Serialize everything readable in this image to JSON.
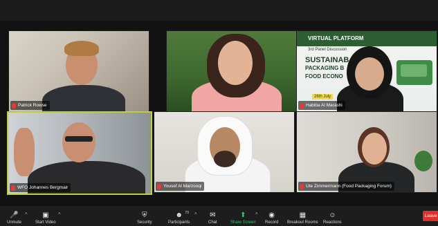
{
  "participants": [
    {
      "name": "Patrick Rowse",
      "muted": true
    },
    {
      "name": "",
      "muted": false
    },
    {
      "name": "Habiba Al Marashi",
      "muted": true
    },
    {
      "name": "WFO Johannes Bergmair",
      "muted": true
    },
    {
      "name": "Yousef Al Marzooqi",
      "muted": true
    },
    {
      "name": "Ute Zimmermann (Food Packaging Forum)",
      "muted": true
    }
  ],
  "slide": {
    "line1": "VIRTUAL PLATFORM",
    "line2": "3rd Panel Discussion",
    "heading_a": "SUSTAINAB",
    "heading_b": "PACKAGING B",
    "heading_c": "FOOD ECONO",
    "date": "26th July"
  },
  "toolbar": {
    "unmute": "Unmute",
    "start_video": "Start Video",
    "security": "Security",
    "participants": "Participants",
    "participants_count": "73",
    "chat": "Chat",
    "share_screen": "Share Screen",
    "record": "Record",
    "breakout_rooms": "Breakout Rooms",
    "reactions": "Reactions",
    "leave": "Leave"
  },
  "icons": {
    "mic": "mic-muted-icon",
    "video": "video-off-icon",
    "security": "shield-icon",
    "participants": "people-icon",
    "chat": "chat-bubble-icon",
    "share": "share-screen-icon",
    "record": "record-icon",
    "breakout": "grid-icon",
    "reactions": "smiley-icon"
  },
  "colors": {
    "active_speaker": "#b9d23a",
    "share_green": "#2ecc71",
    "leave_red": "#e0302c",
    "muted_red": "#e5393a"
  }
}
